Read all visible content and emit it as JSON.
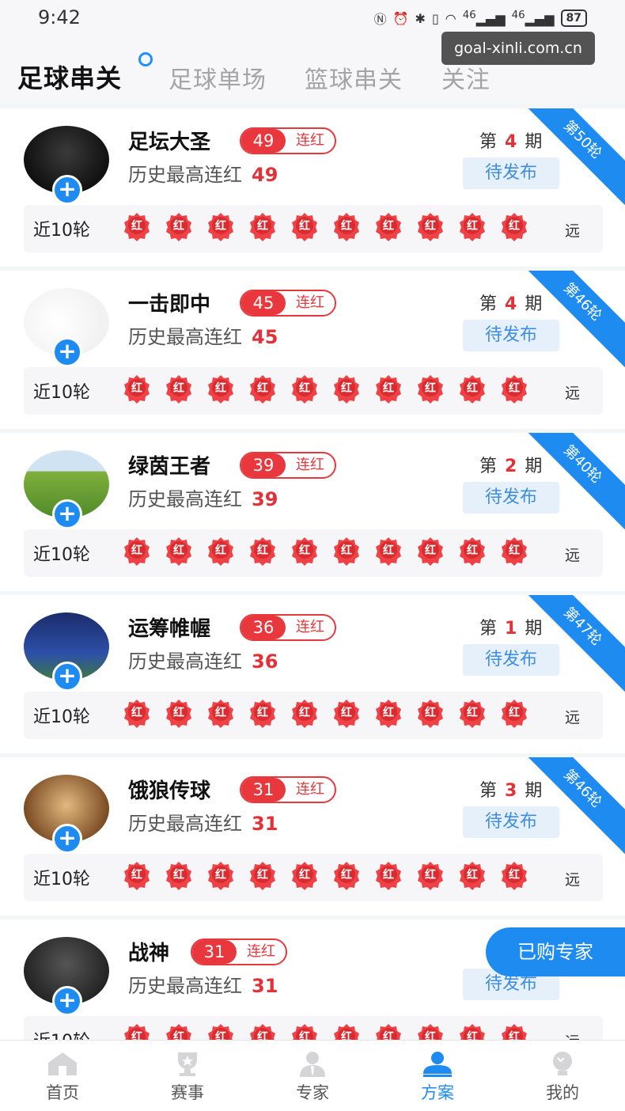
{
  "status_bar": {
    "time": "9:42",
    "battery": "87",
    "net1": "46",
    "net2": "46"
  },
  "watermark": "goal-xinli.com.cn",
  "tabs": [
    "足球串关",
    "足球单场",
    "篮球串关",
    "关注"
  ],
  "labels": {
    "streak_suffix": "连红",
    "history_prefix": "历史最高连红",
    "period_prefix": "第",
    "period_suffix": "期",
    "pending": "待发布",
    "recent": "近10轮",
    "hong": "红",
    "far": "远"
  },
  "experts": [
    {
      "name": "足坛大圣",
      "streak": "49",
      "history_max": "49",
      "period": "4",
      "ribbon": "第50轮"
    },
    {
      "name": "一击即中",
      "streak": "45",
      "history_max": "45",
      "period": "4",
      "ribbon": "第46轮"
    },
    {
      "name": "绿茵王者",
      "streak": "39",
      "history_max": "39",
      "period": "2",
      "ribbon": "第40轮"
    },
    {
      "name": "运筹帷幄",
      "streak": "36",
      "history_max": "36",
      "period": "1",
      "ribbon": "第47轮"
    },
    {
      "name": "饿狼传球",
      "streak": "31",
      "history_max": "31",
      "period": "3",
      "ribbon": "第46轮"
    },
    {
      "name": "战神",
      "streak": "31",
      "history_max": "31",
      "period": "",
      "ribbon": ""
    }
  ],
  "float_button": "已购专家",
  "bottom_nav": [
    "首页",
    "赛事",
    "专家",
    "方案",
    "我的"
  ],
  "colors": {
    "accent": "#1e8bf0",
    "red": "#e8383d"
  }
}
